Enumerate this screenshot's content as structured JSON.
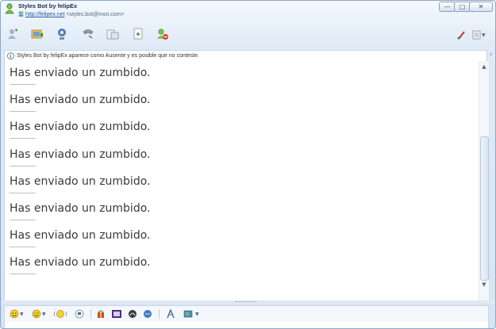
{
  "window": {
    "title": "Styles Bot by felipEx",
    "link": "http://felipex.net",
    "email": "<styles.bot@msn.com>"
  },
  "toolbar": {
    "icons": [
      "invite-contact-icon",
      "send-files-icon",
      "webcam-icon",
      "call-icon",
      "share-folder-icon",
      "games-icon",
      "block-icon"
    ],
    "right_icons": [
      "paint-brush-icon",
      "menu-icon"
    ]
  },
  "infobar": {
    "text": "Styles Bot by felipEx aparece como Ausente y es posible que no conteste."
  },
  "conversation": {
    "messages": [
      {
        "text": "Has enviado un zumbido."
      },
      {
        "text": "Has enviado un zumbido."
      },
      {
        "text": "Has enviado un zumbido."
      },
      {
        "text": "Has enviado un zumbido."
      },
      {
        "text": "Has enviado un zumbido."
      },
      {
        "text": "Has enviado un zumbido."
      },
      {
        "text": "Has enviado un zumbido."
      },
      {
        "text": "Has enviado un zumbido."
      }
    ]
  },
  "format_toolbar": {
    "icons": [
      "emoticon-icon",
      "wink-icon",
      "nudge-icon",
      "voice-clip-icon",
      "gift-icon",
      "background-icon",
      "ink-icon",
      "games-small-icon",
      "font-icon",
      "color-icon"
    ]
  },
  "colors": {
    "accent": "#2a56a8",
    "frame": "#8ea6c4",
    "message_text": "#3a3a3a"
  }
}
